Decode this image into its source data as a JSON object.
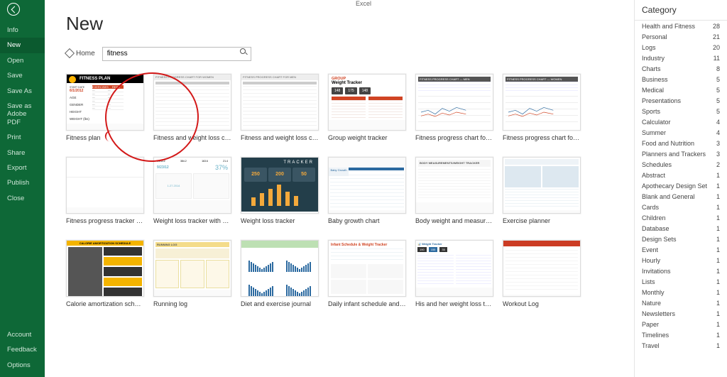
{
  "app_title": "Excel",
  "sidebar": {
    "items": [
      {
        "label": "Info",
        "active": false
      },
      {
        "label": "New",
        "active": true
      },
      {
        "label": "Open",
        "active": false
      },
      {
        "label": "Save",
        "active": false
      },
      {
        "label": "Save As",
        "active": false
      },
      {
        "label": "Save as Adobe PDF",
        "active": false
      },
      {
        "label": "Print",
        "active": false
      },
      {
        "label": "Share",
        "active": false
      },
      {
        "label": "Export",
        "active": false
      },
      {
        "label": "Publish",
        "active": false
      },
      {
        "label": "Close",
        "active": false
      }
    ],
    "bottom": [
      {
        "label": "Account"
      },
      {
        "label": "Feedback"
      },
      {
        "label": "Options"
      }
    ]
  },
  "page": {
    "title": "New",
    "home": "Home",
    "search_value": "fitness"
  },
  "templates_row1": [
    {
      "label": "Fitness plan",
      "kind": "fitnessplan"
    },
    {
      "label": "Fitness and weight loss chart for...",
      "kind": "grid"
    },
    {
      "label": "Fitness and weight loss chart for...",
      "kind": "grid"
    },
    {
      "label": "Group weight tracker",
      "kind": "weight"
    },
    {
      "label": "Fitness progress chart for men (...",
      "kind": "menchart"
    },
    {
      "label": "Fitness progress chart for wome...",
      "kind": "menchart2"
    }
  ],
  "templates_row2": [
    {
      "label": "Fitness progress tracker for men...",
      "kind": "plain"
    },
    {
      "label": "Weight loss tracker with BMI",
      "kind": "bmi"
    },
    {
      "label": "Weight loss tracker",
      "kind": "tracker"
    },
    {
      "label": "Baby growth chart",
      "kind": "baby"
    },
    {
      "label": "Body weight and measurements...",
      "kind": "measure"
    },
    {
      "label": "Exercise planner",
      "kind": "explan"
    }
  ],
  "templates_row3": [
    {
      "label": "Calorie amortization schedule",
      "kind": "cal"
    },
    {
      "label": "Running log",
      "kind": "runlog"
    },
    {
      "label": "Diet and exercise journal",
      "kind": "diet"
    },
    {
      "label": "Daily infant schedule and weigh...",
      "kind": "infant"
    },
    {
      "label": "His and her weight loss tracker",
      "kind": "hisher"
    },
    {
      "label": "Workout Log",
      "kind": "worklog"
    }
  ],
  "fitness_plan_thumb": {
    "title": "FITNESS PLAN",
    "startdate_label": "START DATE",
    "startdate": "6/1/2012",
    "rows": [
      "AGE",
      "GENDER",
      "HEIGHT",
      "WEIGHT (lbs)"
    ],
    "right_head": [
      "EXERCISES",
      "REPS"
    ]
  },
  "weight_tracker": {
    "small": "GROUP",
    "title": "Weight Tracker",
    "cards": [
      "148",
      "175",
      "148"
    ]
  },
  "tracker_thumb": {
    "title": "TRACKER",
    "cards": [
      "250",
      "200",
      "50"
    ],
    "bars": [
      12,
      18,
      24,
      30,
      20,
      14
    ]
  },
  "bmi_thumb": {
    "top_nums": [
      "9/23/12",
      "384.2",
      "163.6",
      "21.4"
    ],
    "pct": "37%",
    "date": "1.27.2014"
  },
  "hisher_thumb": {
    "title": "Weight Tracker",
    "nums": [
      "190",
      "155",
      "35"
    ]
  },
  "category": {
    "title": "Category",
    "items": [
      {
        "name": "Health and Fitness",
        "count": 28
      },
      {
        "name": "Personal",
        "count": 21
      },
      {
        "name": "Logs",
        "count": 20
      },
      {
        "name": "Industry",
        "count": 11
      },
      {
        "name": "Charts",
        "count": 8
      },
      {
        "name": "Business",
        "count": 5
      },
      {
        "name": "Medical",
        "count": 5
      },
      {
        "name": "Presentations",
        "count": 5
      },
      {
        "name": "Sports",
        "count": 5
      },
      {
        "name": "Calculator",
        "count": 4
      },
      {
        "name": "Summer",
        "count": 4
      },
      {
        "name": "Food and Nutrition",
        "count": 3
      },
      {
        "name": "Planners and Trackers",
        "count": 3
      },
      {
        "name": "Schedules",
        "count": 2
      },
      {
        "name": "Abstract",
        "count": 1
      },
      {
        "name": "Apothecary Design Set",
        "count": 1
      },
      {
        "name": "Blank and General",
        "count": 1
      },
      {
        "name": "Cards",
        "count": 1
      },
      {
        "name": "Children",
        "count": 1
      },
      {
        "name": "Database",
        "count": 1
      },
      {
        "name": "Design Sets",
        "count": 1
      },
      {
        "name": "Event",
        "count": 1
      },
      {
        "name": "Hourly",
        "count": 1
      },
      {
        "name": "Invitations",
        "count": 1
      },
      {
        "name": "Lists",
        "count": 1
      },
      {
        "name": "Monthly",
        "count": 1
      },
      {
        "name": "Nature",
        "count": 1
      },
      {
        "name": "Newsletters",
        "count": 1
      },
      {
        "name": "Paper",
        "count": 1
      },
      {
        "name": "Timelines",
        "count": 1
      },
      {
        "name": "Travel",
        "count": 1
      }
    ]
  },
  "thumb_text": {
    "grid_header": "FITNESS PROGRESS CHART FOR WOMEN",
    "grid_header2": "FITNESS PROGRESS CHART FOR MEN",
    "menchart_head": "FITNESS PROGRESS CHART — MEN",
    "menchart_head2": "FITNESS PROGRESS CHART — WOMEN",
    "baby_corner": "Baby Growth",
    "measure_head": "BODY MEASUREMENTS/WEIGHT TRACKER",
    "cal_head": "CALORIE AMORTIZATION SCHEDULE",
    "runlog_head": "RUNNING LOG",
    "infant_title": "Infant Schedule & Weight Tracker"
  }
}
